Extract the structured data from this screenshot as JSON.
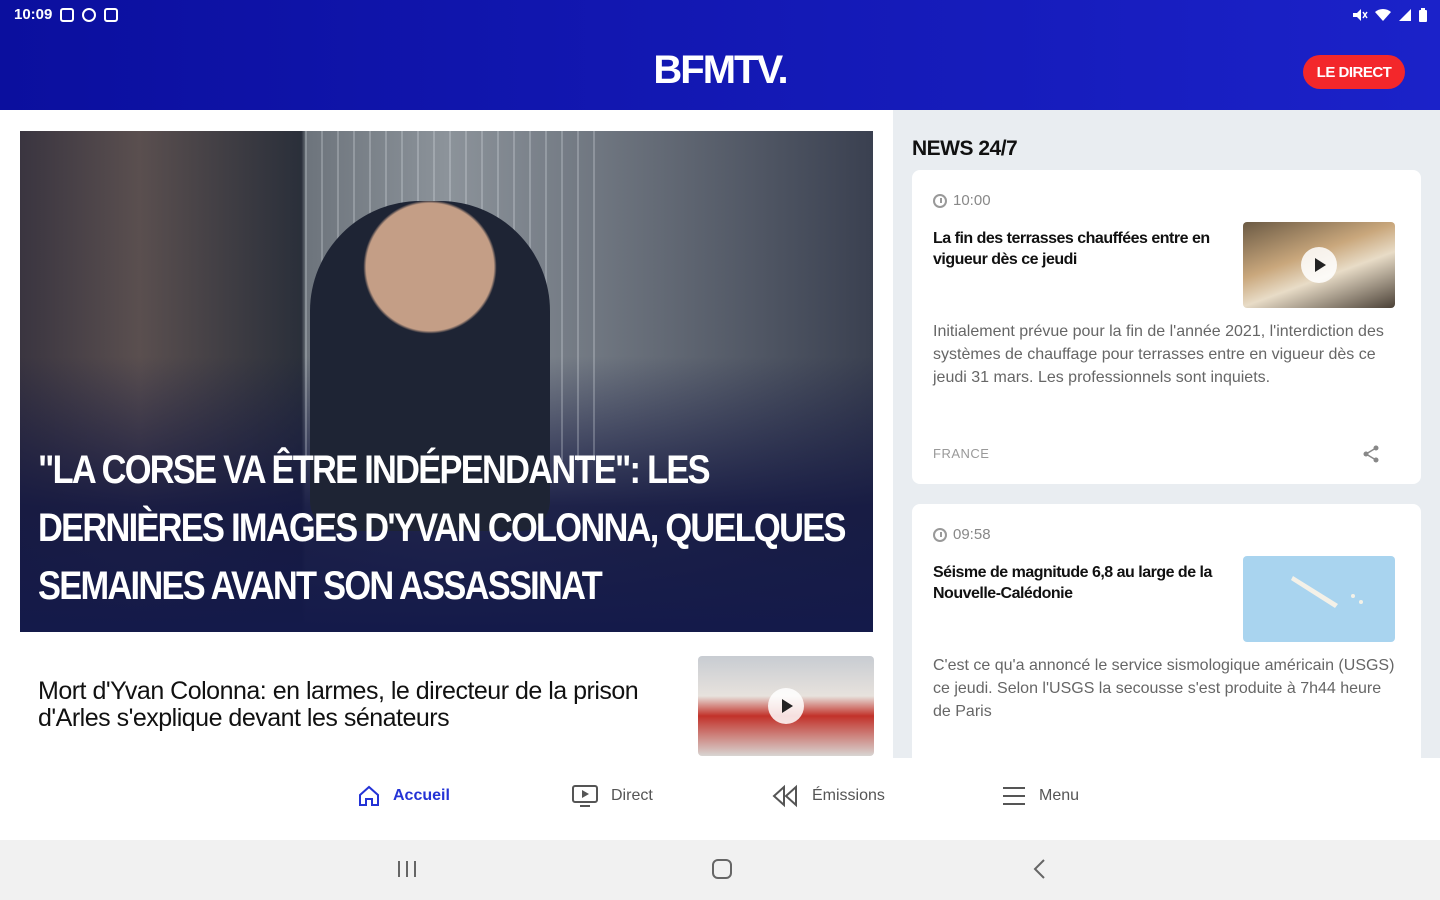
{
  "status_bar": {
    "time": "10:09"
  },
  "header": {
    "logo": "BFMTV.",
    "live_button": "LE DIRECT"
  },
  "hero": {
    "title": "\"LA CORSE VA ÊTRE INDÉPENDANTE\": LES DERNIÈRES IMAGES D'YVAN COLONNA, QUELQUES SEMAINES AVANT SON ASSASSINAT"
  },
  "second_article": {
    "title": "Mort d'Yvan Colonna: en larmes, le directeur de la prison d'Arles s'explique devant les sénateurs"
  },
  "sidebar": {
    "section_title": "NEWS 24/7",
    "cards": [
      {
        "time": "10:00",
        "title": "La fin des terrasses chauffées entre en vigueur dès ce jeudi",
        "description": "Initialement prévue pour la fin de l'année 2021, l'interdiction des systèmes de chauffage pour terrasses entre en vigueur dès ce jeudi 31 mars. Les professionnels sont inquiets.",
        "category": "FRANCE"
      },
      {
        "time": "09:58",
        "title": "Séisme de magnitude 6,8 au large de la Nouvelle-Calédonie",
        "description": "C'est ce qu'a annoncé le service sismologique américain (USGS) ce jeudi. Selon l'USGS la secousse s'est produite à 7h44 heure de Paris"
      }
    ]
  },
  "bottom_nav": [
    {
      "label": "Accueil",
      "icon": "home-icon",
      "active": true
    },
    {
      "label": "Direct",
      "icon": "tv-play-icon"
    },
    {
      "label": "Émissions",
      "icon": "replay-icon"
    },
    {
      "label": "Menu",
      "icon": "menu-icon"
    }
  ],
  "colors": {
    "brand_blue": "#1b22c9",
    "live_red": "#f3272b",
    "active_nav": "#2433d6"
  }
}
